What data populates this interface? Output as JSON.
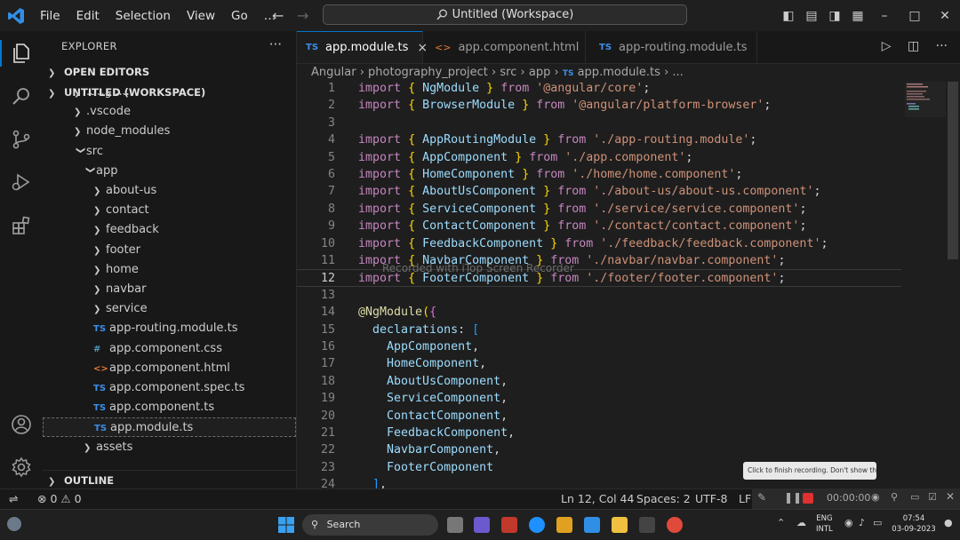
{
  "menu": [
    "File",
    "Edit",
    "Selection",
    "View",
    "Go",
    "…"
  ],
  "command_center": "Untitled (Workspace)",
  "sidebar": {
    "title": "EXPLORER",
    "more": "···",
    "open_editors": "OPEN EDITORS",
    "workspace": "UNTITLED (WORKSPACE)",
    "outline": "OUTLINE",
    "tree": [
      {
        "label": ".angular",
        "indent": 1,
        "type": "folder"
      },
      {
        "label": ".vscode",
        "indent": 1,
        "type": "folder"
      },
      {
        "label": "node_modules",
        "indent": 1,
        "type": "folder"
      },
      {
        "label": "src",
        "indent": 1,
        "type": "folder-open"
      },
      {
        "label": "app",
        "indent": 2,
        "type": "folder-open"
      },
      {
        "label": "about-us",
        "indent": 3,
        "type": "folder"
      },
      {
        "label": "contact",
        "indent": 3,
        "type": "folder"
      },
      {
        "label": "feedback",
        "indent": 3,
        "type": "folder"
      },
      {
        "label": "footer",
        "indent": 3,
        "type": "folder"
      },
      {
        "label": "home",
        "indent": 3,
        "type": "folder"
      },
      {
        "label": "navbar",
        "indent": 3,
        "type": "folder"
      },
      {
        "label": "service",
        "indent": 3,
        "type": "folder"
      },
      {
        "label": "app-routing.module.ts",
        "indent": 3,
        "type": "ts"
      },
      {
        "label": "app.component.css",
        "indent": 3,
        "type": "css"
      },
      {
        "label": "app.component.html",
        "indent": 3,
        "type": "html"
      },
      {
        "label": "app.component.spec.ts",
        "indent": 3,
        "type": "ts"
      },
      {
        "label": "app.component.ts",
        "indent": 3,
        "type": "ts"
      },
      {
        "label": "app.module.ts",
        "indent": 3,
        "type": "ts",
        "selected": true
      },
      {
        "label": "assets",
        "indent": 2,
        "type": "folder"
      }
    ]
  },
  "tabs": [
    {
      "label": "app.module.ts",
      "icon": "TS",
      "active": true,
      "close": "×"
    },
    {
      "label": "app.component.html",
      "icon": "<>",
      "active": false
    },
    {
      "label": "app-routing.module.ts",
      "icon": "TS",
      "active": false
    }
  ],
  "breadcrumb": [
    "Angular",
    "photography_project",
    "src",
    "app",
    "app.module.ts",
    "..."
  ],
  "code_lines": [
    [
      [
        "kw",
        "import"
      ],
      [
        "pun",
        " "
      ],
      [
        "br",
        "{"
      ],
      [
        "pun",
        " "
      ],
      [
        "id",
        "NgModule"
      ],
      [
        "pun",
        " "
      ],
      [
        "br",
        "}"
      ],
      [
        "pun",
        " "
      ],
      [
        "kw",
        "from"
      ],
      [
        "pun",
        " "
      ],
      [
        "str",
        "'@angular/core'"
      ],
      [
        "pun",
        ";"
      ]
    ],
    [
      [
        "kw",
        "import"
      ],
      [
        "pun",
        " "
      ],
      [
        "br",
        "{"
      ],
      [
        "pun",
        " "
      ],
      [
        "id",
        "BrowserModule"
      ],
      [
        "pun",
        " "
      ],
      [
        "br",
        "}"
      ],
      [
        "pun",
        " "
      ],
      [
        "kw",
        "from"
      ],
      [
        "pun",
        " "
      ],
      [
        "str",
        "'@angular/platform-browser'"
      ],
      [
        "pun",
        ";"
      ]
    ],
    [],
    [
      [
        "kw",
        "import"
      ],
      [
        "pun",
        " "
      ],
      [
        "br",
        "{"
      ],
      [
        "pun",
        " "
      ],
      [
        "id",
        "AppRoutingModule"
      ],
      [
        "pun",
        " "
      ],
      [
        "br",
        "}"
      ],
      [
        "pun",
        " "
      ],
      [
        "kw",
        "from"
      ],
      [
        "pun",
        " "
      ],
      [
        "str",
        "'./app-routing.module'"
      ],
      [
        "pun",
        ";"
      ]
    ],
    [
      [
        "kw",
        "import"
      ],
      [
        "pun",
        " "
      ],
      [
        "br",
        "{"
      ],
      [
        "pun",
        " "
      ],
      [
        "id",
        "AppComponent"
      ],
      [
        "pun",
        " "
      ],
      [
        "br",
        "}"
      ],
      [
        "pun",
        " "
      ],
      [
        "kw",
        "from"
      ],
      [
        "pun",
        " "
      ],
      [
        "str",
        "'./app.component'"
      ],
      [
        "pun",
        ";"
      ]
    ],
    [
      [
        "kw",
        "import"
      ],
      [
        "pun",
        " "
      ],
      [
        "br",
        "{"
      ],
      [
        "pun",
        " "
      ],
      [
        "id",
        "HomeComponent"
      ],
      [
        "pun",
        " "
      ],
      [
        "br",
        "}"
      ],
      [
        "pun",
        " "
      ],
      [
        "kw",
        "from"
      ],
      [
        "pun",
        " "
      ],
      [
        "str",
        "'./home/home.component'"
      ],
      [
        "pun",
        ";"
      ]
    ],
    [
      [
        "kw",
        "import"
      ],
      [
        "pun",
        " "
      ],
      [
        "br",
        "{"
      ],
      [
        "pun",
        " "
      ],
      [
        "id",
        "AboutUsComponent"
      ],
      [
        "pun",
        " "
      ],
      [
        "br",
        "}"
      ],
      [
        "pun",
        " "
      ],
      [
        "kw",
        "from"
      ],
      [
        "pun",
        " "
      ],
      [
        "str",
        "'./about-us/about-us.component'"
      ],
      [
        "pun",
        ";"
      ]
    ],
    [
      [
        "kw",
        "import"
      ],
      [
        "pun",
        " "
      ],
      [
        "br",
        "{"
      ],
      [
        "pun",
        " "
      ],
      [
        "id",
        "ServiceComponent"
      ],
      [
        "pun",
        " "
      ],
      [
        "br",
        "}"
      ],
      [
        "pun",
        " "
      ],
      [
        "kw",
        "from"
      ],
      [
        "pun",
        " "
      ],
      [
        "str",
        "'./service/service.component'"
      ],
      [
        "pun",
        ";"
      ]
    ],
    [
      [
        "kw",
        "import"
      ],
      [
        "pun",
        " "
      ],
      [
        "br",
        "{"
      ],
      [
        "pun",
        " "
      ],
      [
        "id",
        "ContactComponent"
      ],
      [
        "pun",
        " "
      ],
      [
        "br",
        "}"
      ],
      [
        "pun",
        " "
      ],
      [
        "kw",
        "from"
      ],
      [
        "pun",
        " "
      ],
      [
        "str",
        "'./contact/contact.component'"
      ],
      [
        "pun",
        ";"
      ]
    ],
    [
      [
        "kw",
        "import"
      ],
      [
        "pun",
        " "
      ],
      [
        "br",
        "{"
      ],
      [
        "pun",
        " "
      ],
      [
        "id",
        "FeedbackComponent"
      ],
      [
        "pun",
        " "
      ],
      [
        "br",
        "}"
      ],
      [
        "pun",
        " "
      ],
      [
        "kw",
        "from"
      ],
      [
        "pun",
        " "
      ],
      [
        "str",
        "'./feedback/feedback.component'"
      ],
      [
        "pun",
        ";"
      ]
    ],
    [
      [
        "kw",
        "import"
      ],
      [
        "pun",
        " "
      ],
      [
        "br",
        "{"
      ],
      [
        "pun",
        " "
      ],
      [
        "id",
        "NavbarComponent"
      ],
      [
        "pun",
        " "
      ],
      [
        "br",
        "}"
      ],
      [
        "pun",
        " "
      ],
      [
        "kw",
        "from"
      ],
      [
        "pun",
        " "
      ],
      [
        "str",
        "'./navbar/navbar.component'"
      ],
      [
        "pun",
        ";"
      ]
    ],
    [
      [
        "kw",
        "import"
      ],
      [
        "pun",
        " "
      ],
      [
        "br",
        "{"
      ],
      [
        "pun",
        " "
      ],
      [
        "id",
        "FooterComponent"
      ],
      [
        "pun",
        " "
      ],
      [
        "br",
        "}"
      ],
      [
        "pun",
        " "
      ],
      [
        "kw",
        "from"
      ],
      [
        "pun",
        " "
      ],
      [
        "str",
        "'./footer/footer.component'"
      ],
      [
        "pun",
        ";"
      ]
    ],
    [],
    [
      [
        "dec",
        "@"
      ],
      [
        "dec",
        "NgModule"
      ],
      [
        "br",
        "("
      ],
      [
        "br2",
        "{"
      ]
    ],
    [
      [
        "pun",
        "  "
      ],
      [
        "id",
        "declarations"
      ],
      [
        "pun",
        ": "
      ],
      [
        "br3",
        "["
      ]
    ],
    [
      [
        "pun",
        "    "
      ],
      [
        "id",
        "AppComponent"
      ],
      [
        "pun",
        ","
      ]
    ],
    [
      [
        "pun",
        "    "
      ],
      [
        "id",
        "HomeComponent"
      ],
      [
        "pun",
        ","
      ]
    ],
    [
      [
        "pun",
        "    "
      ],
      [
        "id",
        "AboutUsComponent"
      ],
      [
        "pun",
        ","
      ]
    ],
    [
      [
        "pun",
        "    "
      ],
      [
        "id",
        "ServiceComponent"
      ],
      [
        "pun",
        ","
      ]
    ],
    [
      [
        "pun",
        "    "
      ],
      [
        "id",
        "ContactComponent"
      ],
      [
        "pun",
        ","
      ]
    ],
    [
      [
        "pun",
        "    "
      ],
      [
        "id",
        "FeedbackComponent"
      ],
      [
        "pun",
        ","
      ]
    ],
    [
      [
        "pun",
        "    "
      ],
      [
        "id",
        "NavbarComponent"
      ],
      [
        "pun",
        ","
      ]
    ],
    [
      [
        "pun",
        "    "
      ],
      [
        "id",
        "FooterComponent"
      ]
    ],
    [
      [
        "pun",
        "  "
      ],
      [
        "br3",
        "]"
      ],
      [
        "pun",
        ","
      ]
    ]
  ],
  "current_line": 12,
  "watermark": "Recorded with iTop Screen Recorder",
  "recorder_tip": "Click to finish recording. Don't show this again",
  "recorder_time": "00:00:00",
  "status": {
    "errors": "0",
    "warnings": "0",
    "position": "Ln 12, Col 44",
    "spaces": "Spaces: 2",
    "encoding": "UTF-8",
    "eol": "LF"
  },
  "taskbar": {
    "search": "Search",
    "lang1": "ENG",
    "lang2": "INTL",
    "time": "07:54",
    "date": "03-09-2023"
  },
  "colors": {
    "accent": "#0078d4",
    "ts_icon": "#3b8eea",
    "html_icon": "#e37933",
    "css_icon": "#519aba"
  }
}
